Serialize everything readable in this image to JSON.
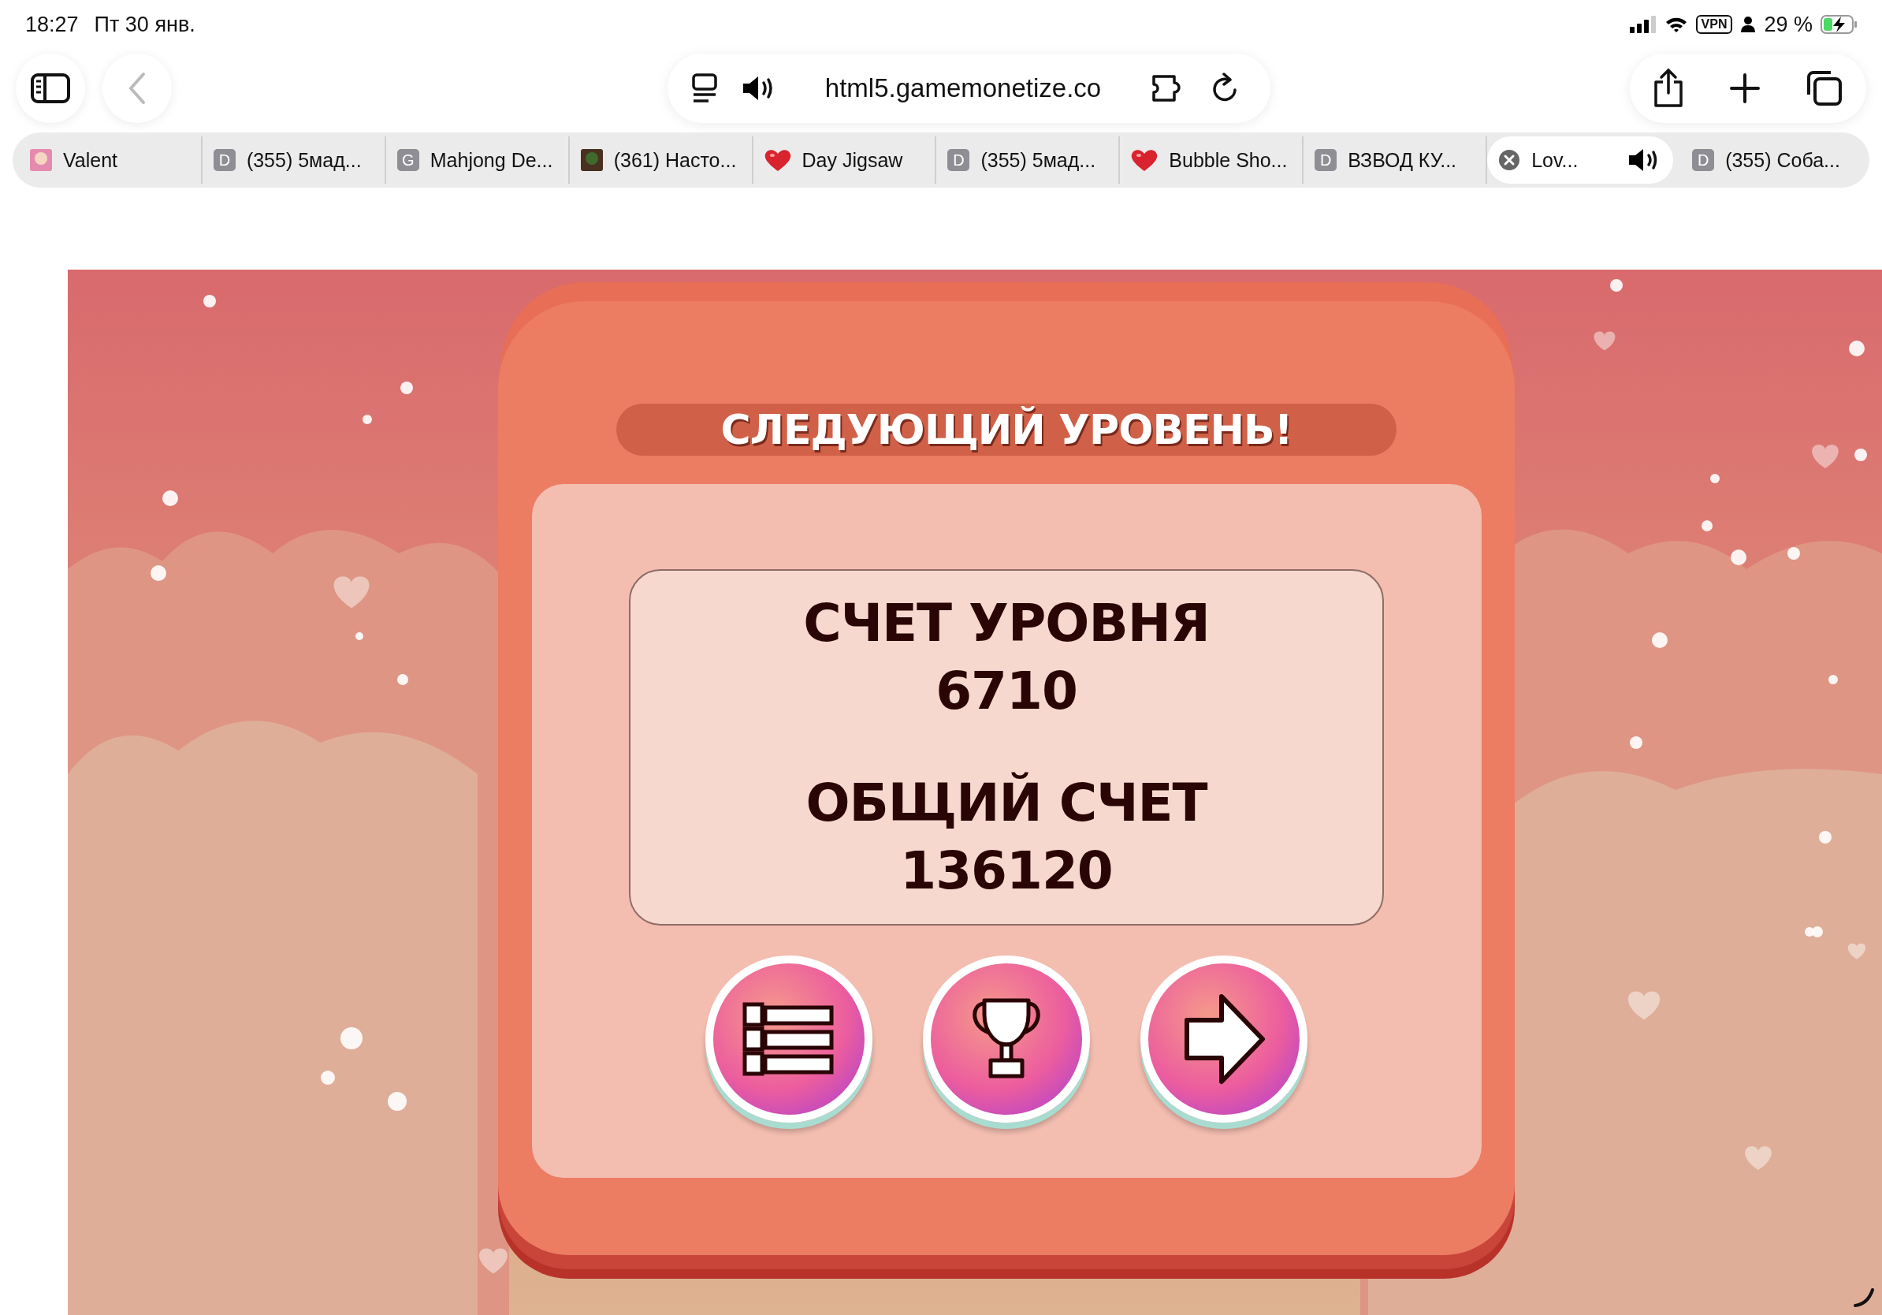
{
  "status_bar": {
    "time": "18:27",
    "date": "Пт 30 янв.",
    "vpn": "VPN",
    "battery": "29 %"
  },
  "address_bar": {
    "url": "html5.gamemonetize.co"
  },
  "tabs": [
    {
      "kind": "image",
      "title": "Valent",
      "selected": false,
      "audio": false
    },
    {
      "kind": "letter",
      "letter": "D",
      "title": "(355) 5мад...",
      "selected": false,
      "audio": false
    },
    {
      "kind": "letter",
      "letter": "G",
      "title": "Mahjong De...",
      "selected": false,
      "audio": false
    },
    {
      "kind": "image",
      "title": "(361) Насто...",
      "selected": false,
      "audio": false
    },
    {
      "kind": "heart",
      "title": "Day Jigsaw",
      "selected": false,
      "audio": false
    },
    {
      "kind": "letter",
      "letter": "D",
      "title": "(355) 5мад...",
      "selected": false,
      "audio": false
    },
    {
      "kind": "heart",
      "title": "Bubble Sho...",
      "selected": false,
      "audio": false
    },
    {
      "kind": "letter",
      "letter": "D",
      "title": "ВЗВОД КУ...",
      "selected": false,
      "audio": false
    },
    {
      "kind": "close",
      "title": "Lov...",
      "selected": true,
      "audio": true
    },
    {
      "kind": "letter",
      "letter": "D",
      "title": "(355) Соба...",
      "selected": false,
      "audio": false
    }
  ],
  "game": {
    "title": "СЛЕДУЮЩИЙ УРОВЕНЬ!",
    "scores": [
      {
        "label": "СЧЕТ УРОВНЯ",
        "value": "6710"
      },
      {
        "label": "ОБЩИЙ СЧЕТ",
        "value": "136120"
      }
    ],
    "buttons": [
      {
        "kind": "menu"
      },
      {
        "kind": "trophy"
      },
      {
        "kind": "next"
      }
    ]
  }
}
